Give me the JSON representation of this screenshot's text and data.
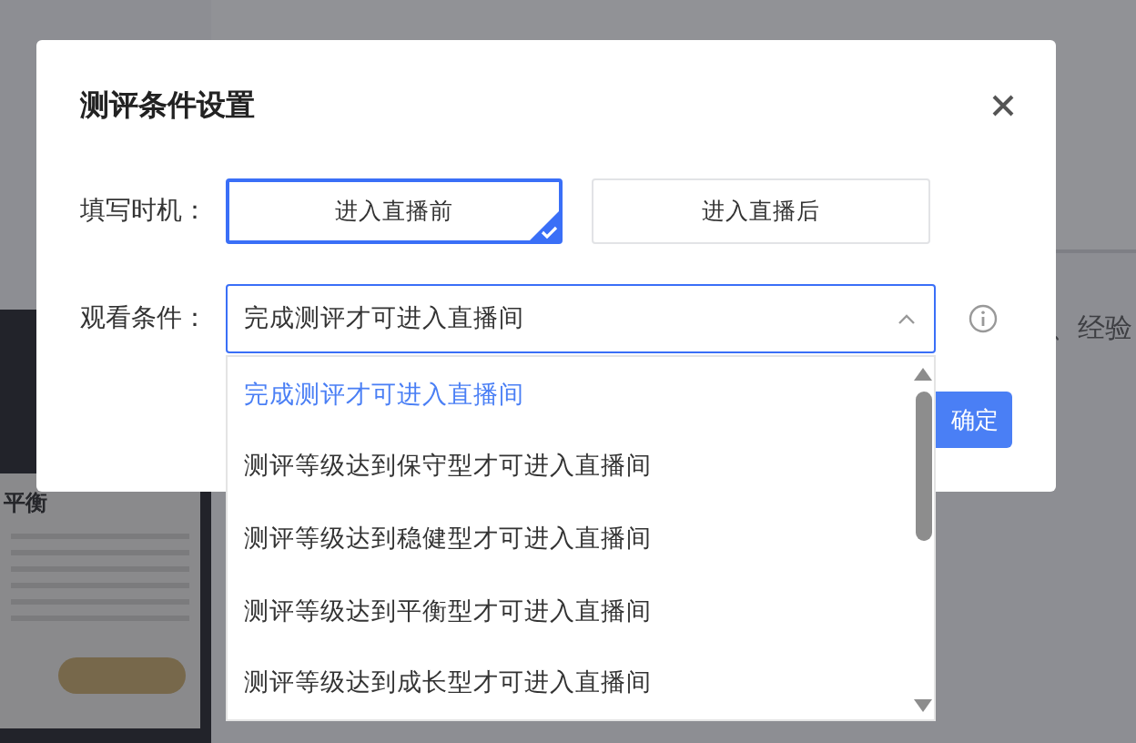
{
  "background": {
    "side_text": "、经验",
    "phone_heading": "平衡"
  },
  "dialog": {
    "title": "测评条件设置",
    "timing": {
      "label": "填写时机：",
      "options": [
        {
          "label": "进入直播前",
          "selected": true
        },
        {
          "label": "进入直播后",
          "selected": false
        }
      ]
    },
    "condition": {
      "label": "观看条件：",
      "value": "完成测评才可进入直播间",
      "expanded": true,
      "options": [
        {
          "label": "完成测评才可进入直播间",
          "selected": true
        },
        {
          "label": "测评等级达到保守型才可进入直播间",
          "selected": false
        },
        {
          "label": "测评等级达到稳健型才可进入直播间",
          "selected": false
        },
        {
          "label": "测评等级达到平衡型才可进入直播间",
          "selected": false
        },
        {
          "label": "测评等级达到成长型才可进入直播间",
          "selected": false
        }
      ]
    },
    "confirm_button": "确定"
  }
}
